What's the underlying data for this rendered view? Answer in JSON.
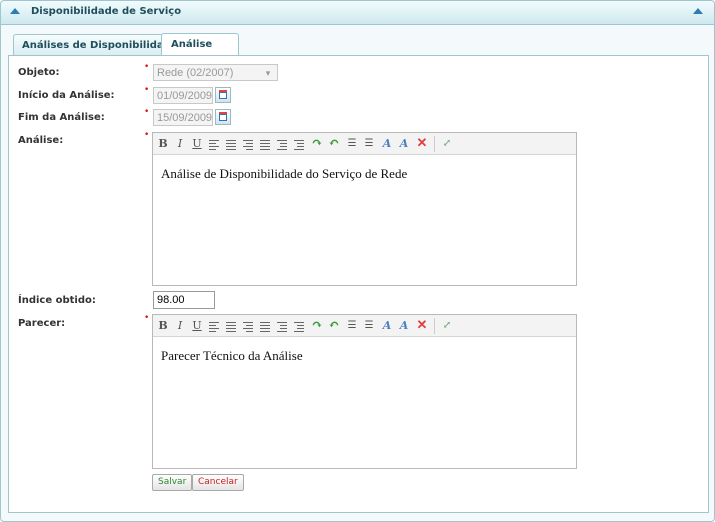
{
  "panel": {
    "title": "Disponibilidade de Serviço"
  },
  "tabs": [
    {
      "label": "Análises de Disponibilidade",
      "active": false
    },
    {
      "label": "Análise",
      "active": true
    }
  ],
  "form": {
    "objeto": {
      "label": "Objeto:",
      "value": "Rede (02/2007)"
    },
    "inicio": {
      "label": "Início da Análise:",
      "value": "01/09/2009"
    },
    "fim": {
      "label": "Fim da Análise:",
      "value": "15/09/2009"
    },
    "analise": {
      "label": "Análise:",
      "content": "Análise de Disponibilidade do Serviço de Rede"
    },
    "indice": {
      "label": "Índice obtido:",
      "value": "98.00"
    },
    "parecer": {
      "label": "Parecer:",
      "content": "Parecer Técnico da Análise"
    },
    "required_mark": "•"
  },
  "toolbar": {
    "bold": "B",
    "italic": "I",
    "underline": "U"
  },
  "buttons": {
    "save": "Salvar",
    "cancel": "Cancelar"
  },
  "colors": {
    "accent": "#2a7db7",
    "required": "#dd1111",
    "save_text": "#2a8a2a",
    "cancel_text": "#cc2222"
  }
}
